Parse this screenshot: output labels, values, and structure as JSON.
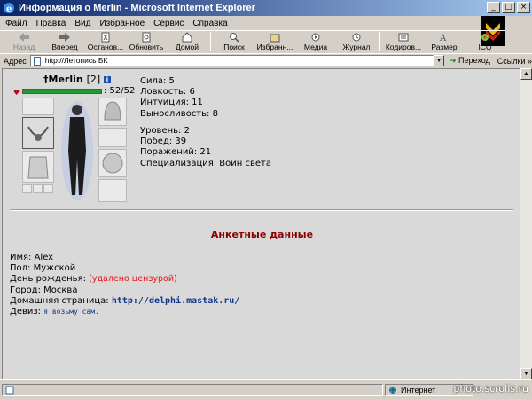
{
  "window": {
    "title": "Информация о Merlin - Microsoft Internet Explorer",
    "minimize": "_",
    "maximize": "□",
    "close": "×"
  },
  "menu": [
    "Файл",
    "Правка",
    "Вид",
    "Избранное",
    "Сервис",
    "Справка"
  ],
  "toolbar": {
    "back": "Назад",
    "forward": "Вперед",
    "stop": "Останов...",
    "refresh": "Обновить",
    "home": "Домой",
    "search": "Поиск",
    "favorites": "Избранн...",
    "media": "Медиа",
    "history": "Журнал",
    "encoding": "Кодиров...",
    "size": "Размер",
    "icq": "ICQ"
  },
  "address": {
    "label": "Адрес",
    "url": "http://Летопись БК",
    "go": "Переход",
    "links": "Ссылки »"
  },
  "character": {
    "name": "Merlin",
    "level_tag": "[2]",
    "info_icon_label": "i",
    "hp_text": ": 52/52",
    "hp_fraction": 1.0,
    "stats": [
      "Сила: 5",
      "Ловкость: 6",
      "Интуиция: 11",
      "Выносливость: 8"
    ],
    "record": [
      "Уровень: 2",
      "Побед: 39",
      "Поражений: 21",
      "Специализация: Воин света"
    ]
  },
  "profile": {
    "title": "Анкетные данные",
    "name": "Имя: Alex",
    "sex": "Пол: Мужской",
    "birthday_label": "День рожденья: ",
    "birthday_value": "(удалено цензурой)",
    "city": "Город: Москва",
    "homepage_label": "Домашняя страница: ",
    "homepage_value": "http://delphi.mastak.ru/",
    "motto_label": "Девиз: ",
    "motto_value": "я возьму сам."
  },
  "status": {
    "zone": "Интернет"
  },
  "watermark": "photo.scrolls.ru",
  "colors": {
    "titlebar_start": "#0a246a",
    "hp_fill": "#1f9b2f",
    "section_title": "#8b0000",
    "censored": "#e8141b",
    "link": "#13378a"
  }
}
